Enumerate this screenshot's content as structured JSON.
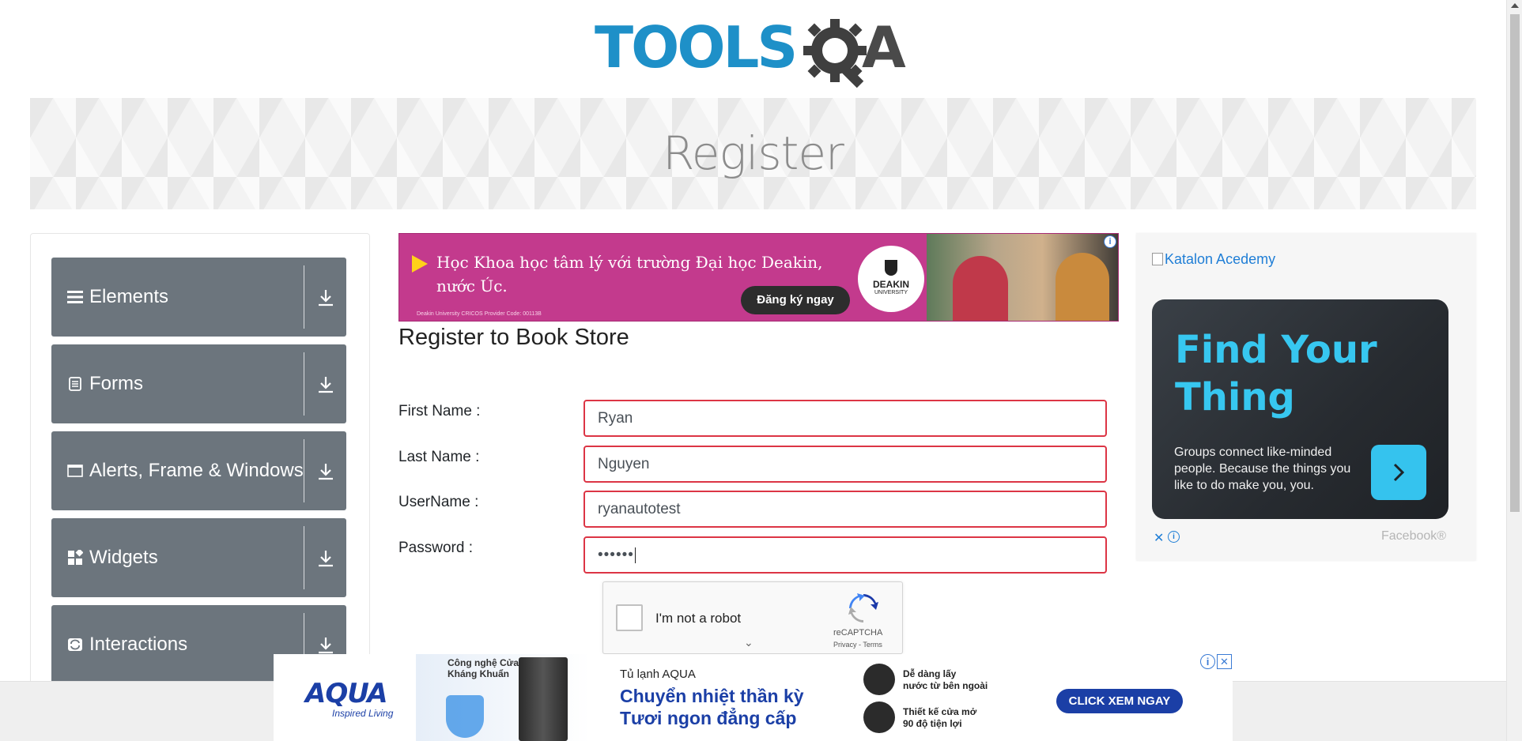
{
  "header": {
    "logo_text": "TOOLS",
    "logo_a": "A"
  },
  "banner": {
    "title": "Register"
  },
  "sidebar": {
    "groups": [
      {
        "label": "Elements",
        "icon": "hamburger-icon"
      },
      {
        "label": "Forms",
        "icon": "document-icon"
      },
      {
        "label": "Alerts, Frame & Windows",
        "icon": "window-icon"
      },
      {
        "label": "Widgets",
        "icon": "widgets-icon"
      },
      {
        "label": "Interactions",
        "icon": "refresh-icon"
      }
    ]
  },
  "ad_top": {
    "line1": "Học Khoa học tâm lý với trường Đại học Deakin,",
    "line2": "nước Úc.",
    "fine_print": "Deakin University CRICOS Provider Code: 00113B",
    "cta": "Đăng ký ngay",
    "brand": "DEAKIN",
    "brand_sub": "UNIVERSITY"
  },
  "form": {
    "title": "Register to Book Store",
    "fields": [
      {
        "label": "First Name :",
        "value": "Ryan"
      },
      {
        "label": "Last Name :",
        "value": "Nguyen"
      },
      {
        "label": "UserName :",
        "value": "ryanautotest"
      },
      {
        "label": "Password :",
        "value": "••••••"
      }
    ]
  },
  "recaptcha": {
    "label": "I'm not a robot",
    "name": "reCAPTCHA",
    "links": "Privacy - Terms"
  },
  "ad_right": {
    "alt_text": "Katalon Acedemy",
    "title": "Find Your\nThing",
    "text": "Groups connect like-minded people. Because the things you like to do make you, you.",
    "footer": "Facebook®"
  },
  "ad_bottom": {
    "brand": "AQUA",
    "brand_sub": "Inspired Living",
    "promo": "Công nghệ Cửa Tủ Kháng Khuẩn",
    "product": "Tủ lạnh AQUA",
    "headline1": "Chuyển nhiệt thần kỳ",
    "headline2": "Tươi ngon đẳng cấp",
    "feature1": "Dễ dàng lấy\nnước từ bên ngoài",
    "feature2": "Thiết kế cửa mở\n90 độ tiện lợi",
    "cta": "CLICK XEM NGAY"
  },
  "colors": {
    "sidebar_group": "#6c757d",
    "invalid_border": "#dc3545",
    "logo_blue": "#1e90c8",
    "ad_pink": "#c33a8d",
    "facebook_card_accent": "#37c7f0",
    "aqua_blue": "#1b3fa6"
  }
}
